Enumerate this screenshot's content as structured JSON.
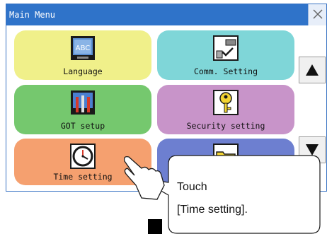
{
  "window": {
    "title": "Main Menu"
  },
  "menu": {
    "items": [
      {
        "label": "Language",
        "icon": "language-icon",
        "color": "#f0f08a"
      },
      {
        "label": "Comm. Setting",
        "icon": "comm-cable-icon",
        "color": "#7fd6d8"
      },
      {
        "label": "GOT setup",
        "icon": "got-tools-icon",
        "color": "#75c86e"
      },
      {
        "label": "Security setting",
        "icon": "key-icon",
        "color": "#c894c9"
      },
      {
        "label": "Time setting",
        "icon": "clock-icon",
        "color": "#f5a06f"
      },
      {
        "label": "",
        "icon": "folder-icon",
        "color": "#6d7fd0"
      }
    ]
  },
  "scroll": {
    "up_icon": "triangle-up-icon",
    "down_icon": "triangle-down-icon"
  },
  "callout": {
    "line1": "Touch",
    "line2": "[Time setting]."
  }
}
